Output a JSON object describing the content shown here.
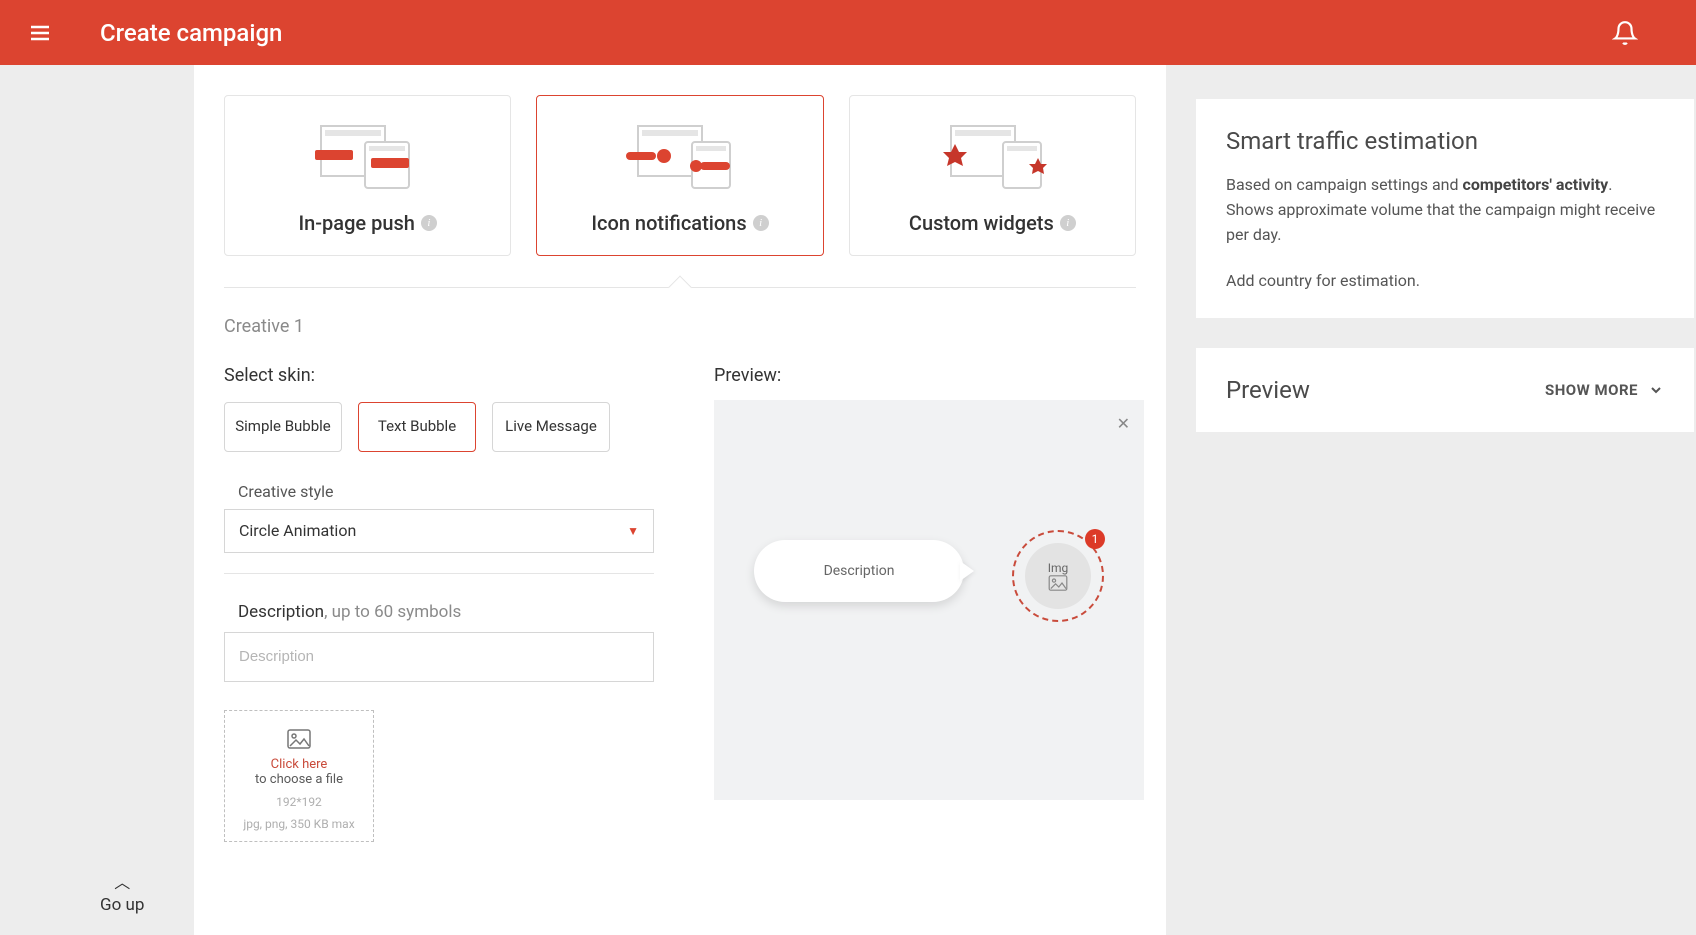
{
  "header": {
    "title": "Create campaign"
  },
  "cards": [
    {
      "title": "In-page push"
    },
    {
      "title": "Icon notifications"
    },
    {
      "title": "Custom widgets"
    }
  ],
  "creative": {
    "label": "Creative 1",
    "skin_label": "Select skin:",
    "skins": [
      "Simple Bubble",
      "Text Bubble",
      "Live Message"
    ],
    "style_label": "Creative style",
    "style_value": "Circle Animation",
    "desc_label": "Description",
    "desc_hint": ", up to 60 symbols",
    "desc_placeholder": "Description"
  },
  "upload": {
    "click": "Click here",
    "choose": "to choose a file",
    "dims": "192*192",
    "limit": "jpg, png, 350 KB max"
  },
  "preview": {
    "label": "Preview:",
    "bubble_text": "Description",
    "img_label": "Img",
    "badge": "1"
  },
  "sidebar": {
    "estimation": {
      "title": "Smart traffic estimation",
      "text_before": "Based on campaign settings and ",
      "text_bold": "competitors' activity",
      "text_after": ". Shows approximate volume that the campaign might receive per day.",
      "add_country": "Add country for estimation."
    },
    "preview": {
      "title": "Preview",
      "show_more": "SHOW MORE"
    }
  },
  "go_up": "Go up"
}
